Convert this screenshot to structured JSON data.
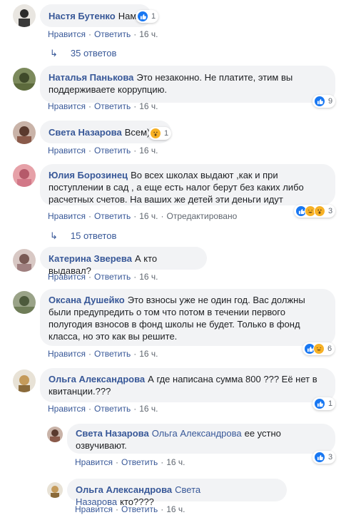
{
  "actions": {
    "like": "Нравится",
    "reply": "Ответить",
    "sep": "·",
    "edited": "Отредактировано"
  },
  "comments": [
    {
      "author": "Настя Бутенко",
      "text": "Нам",
      "reactions": [
        "like"
      ],
      "count": "1",
      "time": "16 ч."
    },
    {
      "author": "Наталья Панькова",
      "text": "Это незаконно. Не платите, этим вы поддерживаете коррупцию.",
      "reactions": [
        "like"
      ],
      "count": "9",
      "time": "16 ч."
    },
    {
      "author": "Света Назарова",
      "text": "Всем)",
      "reactions": [
        "wow"
      ],
      "count": "1",
      "time": "16 ч."
    },
    {
      "author": "Юлия Борозинец",
      "text": "Во всех школах выдают ,как и при поступлении в сад , а еще есть налог берут без каких либо расчетных счетов. На ваших же детей эти деньги идут",
      "reactions": [
        "like",
        "haha",
        "wow"
      ],
      "count": "3",
      "time": "16 ч."
    },
    {
      "author": "Катерина Зверева",
      "text": "А кто выдавал?",
      "time": "16 ч."
    },
    {
      "author": "Оксана Душейко",
      "text": "Это взносы уже не один год. Вас должны были предупредить о том что потом в течении первого полугодия взносов в фонд школы не будет. Только в фонд класса, но это как вы решите.",
      "reactions": [
        "like",
        "haha"
      ],
      "count": "6",
      "time": "16 ч."
    },
    {
      "author": "Ольга Александрова",
      "text": "А где написана сумма 800 ??? Её нет в квитанции.???",
      "reactions": [
        "like"
      ],
      "count": "1",
      "time": "16 ч."
    },
    {
      "author": "Света Назарова",
      "mention": "Ольга Александрова",
      "text": "ее устно озвучивают.",
      "reactions": [
        "like"
      ],
      "count": "3",
      "time": "16 ч."
    },
    {
      "author": "Ольга Александрова",
      "mention": "Света Назарова",
      "text": "кто????",
      "time": "16 ч."
    }
  ],
  "replies_links": [
    "35 ответов",
    "15 ответов"
  ],
  "colors": {
    "link": "#385898",
    "bubble": "#f2f3f5",
    "meta": "#606770",
    "like": "#1877f2",
    "emoji": "#f7b125"
  }
}
